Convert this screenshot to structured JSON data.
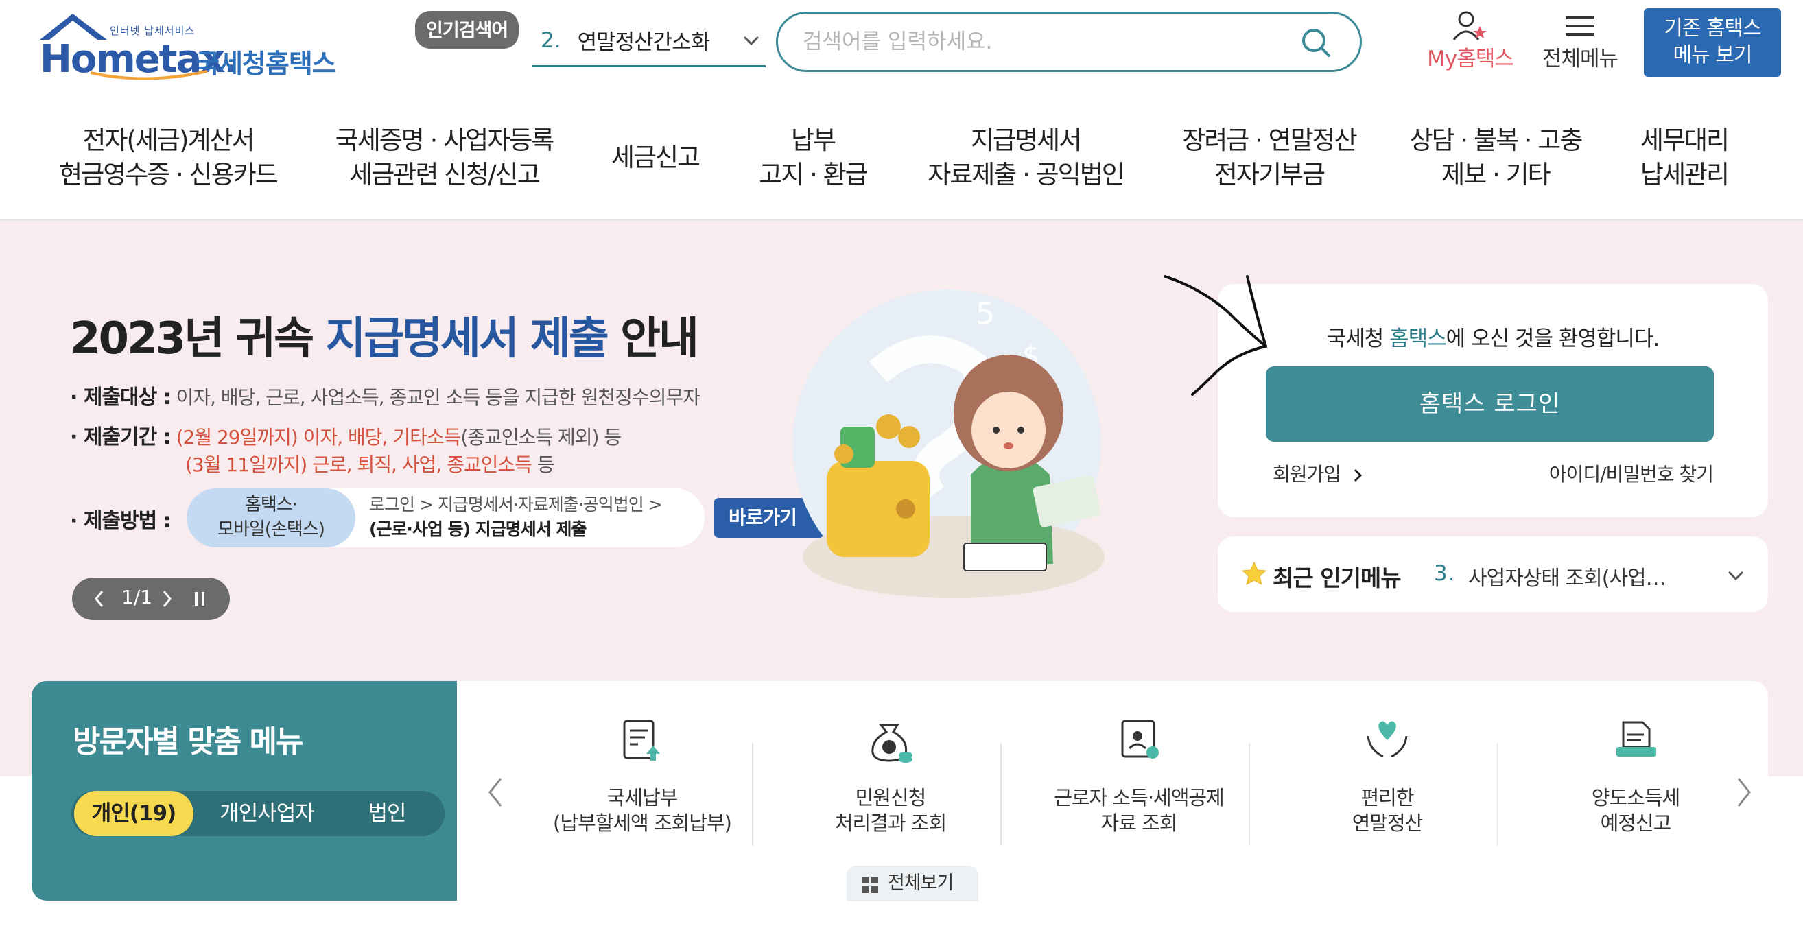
{
  "logo": {
    "tagline": "인터넷 납세서비스",
    "word": "Hometax.",
    "korean": "국세청홈택스"
  },
  "popular_search": {
    "tag": "인기검색어",
    "rank": "2.",
    "term": "연말정산간소화"
  },
  "search": {
    "placeholder": "검색어를 입력하세요."
  },
  "header": {
    "my_label": "My홈택스",
    "all_menu_label": "전체메뉴",
    "old_menu": [
      "기존 홈택스",
      "메뉴 보기"
    ]
  },
  "gnb": [
    [
      "전자(세금)계산서",
      "현금영수증 · 신용카드"
    ],
    [
      "국세증명 · 사업자등록",
      "세금관련 신청/신고"
    ],
    [
      "세금신고"
    ],
    [
      "납부",
      "고지 · 환급"
    ],
    [
      "지급명세서",
      "자료제출 · 공익법인"
    ],
    [
      "장려금 · 연말정산",
      "전자기부금"
    ],
    [
      "상담 · 불복 · 고충",
      "제보 · 기타"
    ],
    [
      "세무대리",
      "납세관리"
    ]
  ],
  "hero": {
    "title_pre": "2023년 귀속 ",
    "title_hl": "지급명세서 제출",
    "title_post": " 안내",
    "target_label": "· 제출대상 :",
    "target_text": "이자, 배당, 근로, 사업소득, 종교인 소득 등을 지급한 원천징수의무자",
    "period_label": "· 제출기간 :",
    "period1_red": "(2월 29일까지) 이자, 배당, 기타소득",
    "period1_rest": "(종교인소득 제외) 등",
    "period2_red": "(3월 11일까지) 근로, 퇴직, 사업, 종교인소득",
    "period2_rest": " 등",
    "method_label": "· 제출방법 :",
    "method_pill": [
      "홈택스·",
      "모바일(손택스)"
    ],
    "method_line1": "로그인 > 지급명세서·자료제출·공익법인 >",
    "method_line2": "(근로·사업 등) 지급명세서 제출",
    "goto": "바로가기",
    "pager": "1/1"
  },
  "login": {
    "welcome_pre": "국세청 ",
    "welcome_hl": "홈택스",
    "welcome_post": "에 오신 것을 환영합니다.",
    "button": "홈택스 로그인",
    "join": "회원가입",
    "find": "아이디/비밀번호 찾기"
  },
  "recent": {
    "title": "최근 인기메뉴",
    "rank": "3.",
    "term": "사업자상태 조회(사업…"
  },
  "visitor": {
    "title": "방문자별 맞춤 메뉴",
    "tabs": [
      "개인(19)",
      "개인사업자",
      "법인"
    ]
  },
  "quick_menu": [
    {
      "line1": "국세납부",
      "line2": "(납부할세액 조회납부)",
      "icon": "tax-payment-icon"
    },
    {
      "line1": "민원신청",
      "line2": "처리결과 조회",
      "icon": "money-bag-icon"
    },
    {
      "line1": "근로자 소득·세액공제",
      "line2": "자료 조회",
      "icon": "certificate-icon"
    },
    {
      "line1": "편리한",
      "line2": "연말정산",
      "icon": "heart-hands-icon"
    },
    {
      "line1": "양도소득세",
      "line2": "예정신고",
      "icon": "document-tray-icon"
    }
  ],
  "view_all": "전체보기",
  "colors": {
    "brand_teal": "#3d8a92",
    "brand_blue": "#2b6ab3",
    "hero_bg": "#f9ecee",
    "accent_red": "#d4513d",
    "tab_yellow": "#f6d94f"
  }
}
